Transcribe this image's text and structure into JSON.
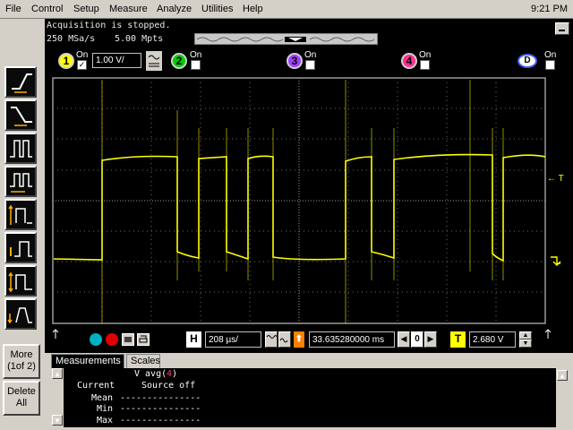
{
  "menu": {
    "file": "File",
    "control": "Control",
    "setup": "Setup",
    "measure": "Measure",
    "analyze": "Analyze",
    "utilities": "Utilities",
    "help": "Help",
    "clock": "9:21 PM"
  },
  "status": {
    "acquisition": "Acquisition is stopped.",
    "sample_rate": "250 MSa/s",
    "memory_depth": "5.00 Mpts"
  },
  "channels": [
    {
      "num": "1",
      "on_label": "On",
      "checked": true,
      "color": "#ffff00"
    },
    {
      "num": "2",
      "on_label": "On",
      "checked": false,
      "color": "#00cc00"
    },
    {
      "num": "3",
      "on_label": "On",
      "checked": false,
      "color": "#a040ff"
    },
    {
      "num": "4",
      "on_label": "On",
      "checked": false,
      "color": "#ff3090"
    }
  ],
  "channel1_scale": "1.00 V/",
  "digital": {
    "label": "D",
    "on_label": "On"
  },
  "trigger_marker": "← T",
  "horizontal": {
    "h_label": "H",
    "time_per_div": "208 µs/",
    "delay_label": "⬆",
    "delay": "33.635280000 ms",
    "zero_label": "0"
  },
  "trigger": {
    "t_label": "T",
    "level": "2.680 V"
  },
  "sidebar": {
    "more_label": "More",
    "more_sub": "(1of 2)",
    "delete_label": "Delete",
    "delete_sub": "All"
  },
  "tabs": {
    "measurements": "Measurements",
    "scales": "Scales"
  },
  "measurements": {
    "name": "V avg(",
    "name_channel": "4",
    "name_close": ")",
    "current_label": "Current",
    "current_value": "Source off",
    "mean_label": "Mean",
    "min_label": "Min",
    "max_label": "Max",
    "dashes": "---------------"
  },
  "colors": {
    "trace": "#ffff00",
    "grid": "#8a8a8a",
    "background": "#000000"
  }
}
